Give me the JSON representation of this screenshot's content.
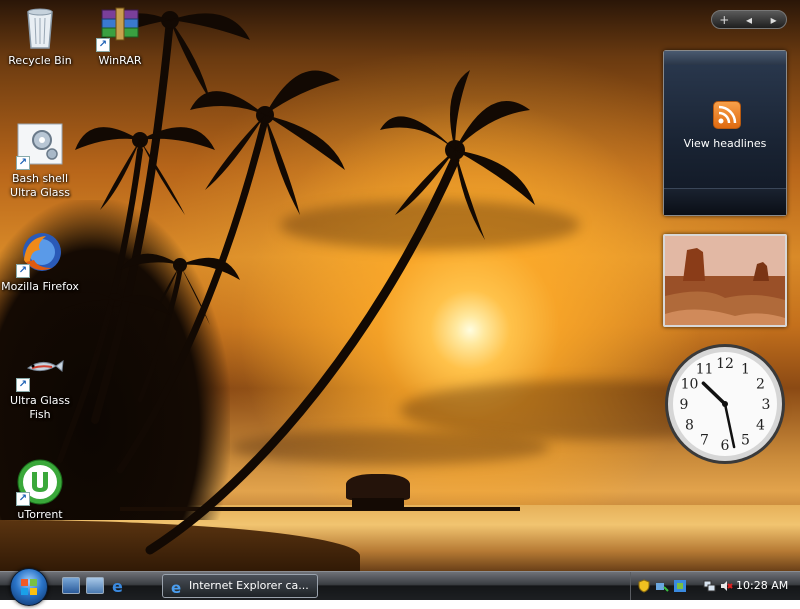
{
  "desktop_icons": [
    {
      "label": "Recycle Bin",
      "icon": "recycle-bin-icon"
    },
    {
      "label": "WinRAR",
      "icon": "winrar-icon"
    },
    {
      "label": "Bash shell Ultra Glass",
      "icon": "gear-settings-icon"
    },
    {
      "label": "Mozilla Firefox",
      "icon": "firefox-icon"
    },
    {
      "label": "Ultra Glass Fish",
      "icon": "fish-icon"
    },
    {
      "label": "uTorrent",
      "icon": "utorrent-icon"
    }
  ],
  "gadget_bar": {
    "add": "+",
    "prev": "◂",
    "next": "▸"
  },
  "feed_gadget": {
    "label": "View headlines",
    "icon": "rss-icon"
  },
  "photo_gadget": {
    "icon": "slideshow-photo-icon"
  },
  "clock_gadget": {
    "numerals": [
      "12",
      "1",
      "2",
      "3",
      "4",
      "5",
      "6",
      "7",
      "8",
      "9",
      "10",
      "11"
    ],
    "hour": 10,
    "minute": 28
  },
  "taskbar": {
    "start_icon": "windows-orb-icon",
    "quick_launch": [
      "show-desktop-icon",
      "switch-windows-icon",
      "internet-explorer-icon"
    ],
    "task_button_label": "Internet Explorer ca...",
    "tray_icons": [
      "security-shield-icon",
      "network-status-icon",
      "windows-update-icon",
      "network-icon",
      "volume-muted-icon"
    ],
    "clock": "10:28 AM"
  },
  "colors": {
    "sky_accent": "#d98a28",
    "rss_orange": "#f08020",
    "taskbar_dark": "#1d1f22"
  }
}
